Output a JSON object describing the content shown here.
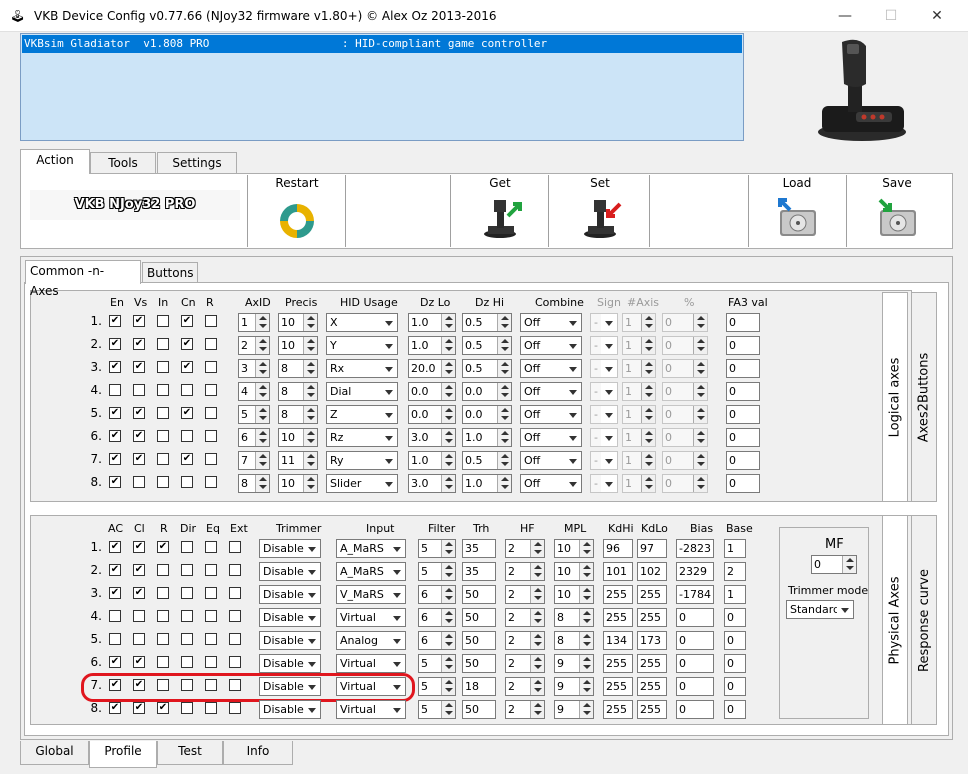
{
  "window": {
    "title": "VKB Device Config v0.77.66 (NJoy32 firmware v1.80+) © Alex Oz 2013-2016"
  },
  "device_list": {
    "selected": "VKBsim Gladiator  v1.808 PRO                    : HID-compliant game controller"
  },
  "top_tabs": [
    {
      "label": "Action"
    },
    {
      "label": "Tools"
    },
    {
      "label": "Settings"
    }
  ],
  "device_name": "VKB NJoy32 PRO",
  "toolbar": {
    "restart": "Restart",
    "get": "Get",
    "set": "Set",
    "load": "Load",
    "save": "Save"
  },
  "inner_tabs": [
    {
      "label": "Common -n- Axes"
    },
    {
      "label": "Buttons"
    }
  ],
  "logical": {
    "headers": {
      "en": "En",
      "vs": "Vs",
      "in": "In",
      "cn": "Cn",
      "r": "R",
      "axid": "AxID",
      "precis": "Precis",
      "hid": "HID Usage",
      "dzlo": "Dz Lo",
      "dzhi": "Dz Hi",
      "combine": "Combine",
      "sign": "Sign",
      "naxis": "#Axis",
      "pct": "%",
      "fa3": "FA3 val"
    },
    "rows": [
      {
        "n": "1.",
        "en": true,
        "vs": true,
        "in": false,
        "cn": true,
        "r": false,
        "axid": "1",
        "precis": "10",
        "hid": "X",
        "dzlo": "1.0",
        "dzhi": "0.5",
        "combine": "Off",
        "sign": "-",
        "naxis": "1",
        "pct": "0",
        "fa3": "0"
      },
      {
        "n": "2.",
        "en": true,
        "vs": true,
        "in": false,
        "cn": true,
        "r": false,
        "axid": "2",
        "precis": "10",
        "hid": "Y",
        "dzlo": "1.0",
        "dzhi": "0.5",
        "combine": "Off",
        "sign": "-",
        "naxis": "1",
        "pct": "0",
        "fa3": "0"
      },
      {
        "n": "3.",
        "en": true,
        "vs": true,
        "in": false,
        "cn": true,
        "r": false,
        "axid": "3",
        "precis": "8",
        "hid": "Rx",
        "dzlo": "20.0",
        "dzhi": "0.5",
        "combine": "Off",
        "sign": "-",
        "naxis": "1",
        "pct": "0",
        "fa3": "0"
      },
      {
        "n": "4.",
        "en": false,
        "vs": false,
        "in": false,
        "cn": false,
        "r": false,
        "axid": "4",
        "precis": "8",
        "hid": "Dial",
        "dzlo": "0.0",
        "dzhi": "0.0",
        "combine": "Off",
        "sign": "-",
        "naxis": "1",
        "pct": "0",
        "fa3": "0"
      },
      {
        "n": "5.",
        "en": true,
        "vs": true,
        "in": false,
        "cn": true,
        "r": false,
        "axid": "5",
        "precis": "8",
        "hid": "Z",
        "dzlo": "0.0",
        "dzhi": "0.0",
        "combine": "Off",
        "sign": "-",
        "naxis": "1",
        "pct": "0",
        "fa3": "0"
      },
      {
        "n": "6.",
        "en": true,
        "vs": true,
        "in": false,
        "cn": false,
        "r": false,
        "axid": "6",
        "precis": "10",
        "hid": "Rz",
        "dzlo": "3.0",
        "dzhi": "1.0",
        "combine": "Off",
        "sign": "-",
        "naxis": "1",
        "pct": "0",
        "fa3": "0"
      },
      {
        "n": "7.",
        "en": true,
        "vs": true,
        "in": false,
        "cn": true,
        "r": false,
        "axid": "7",
        "precis": "11",
        "hid": "Ry",
        "dzlo": "1.0",
        "dzhi": "0.5",
        "combine": "Off",
        "sign": "-",
        "naxis": "1",
        "pct": "0",
        "fa3": "0"
      },
      {
        "n": "8.",
        "en": true,
        "vs": false,
        "in": false,
        "cn": false,
        "r": false,
        "axid": "8",
        "precis": "10",
        "hid": "Slider",
        "dzlo": "3.0",
        "dzhi": "1.0",
        "combine": "Off",
        "sign": "-",
        "naxis": "1",
        "pct": "0",
        "fa3": "0"
      }
    ]
  },
  "physical": {
    "headers": {
      "ac": "AC",
      "cl": "Cl",
      "r": "R",
      "dir": "Dir",
      "eq": "Eq",
      "ext": "Ext",
      "trimmer": "Trimmer",
      "input": "Input",
      "filter": "Filter",
      "trh": "Trh",
      "hf": "HF",
      "mpl": "MPL",
      "kdhi": "KdHi",
      "kdlo": "KdLo",
      "bias": "Bias",
      "base": "Base"
    },
    "rows": [
      {
        "n": "1.",
        "ac": true,
        "cl": true,
        "r": true,
        "dir": false,
        "eq": false,
        "ext": false,
        "trimmer": "Disable",
        "input": "A_MaRS",
        "filter": "5",
        "trh": "35",
        "hf": "2",
        "mpl": "10",
        "kdhi": "96",
        "kdlo": "97",
        "bias": "-2823",
        "base": "1"
      },
      {
        "n": "2.",
        "ac": true,
        "cl": true,
        "r": false,
        "dir": false,
        "eq": false,
        "ext": false,
        "trimmer": "Disable",
        "input": "A_MaRS",
        "filter": "5",
        "trh": "35",
        "hf": "2",
        "mpl": "10",
        "kdhi": "101",
        "kdlo": "102",
        "bias": "2329",
        "base": "2"
      },
      {
        "n": "3.",
        "ac": true,
        "cl": true,
        "r": false,
        "dir": false,
        "eq": false,
        "ext": false,
        "trimmer": "Disable",
        "input": "V_MaRS",
        "filter": "6",
        "trh": "50",
        "hf": "2",
        "mpl": "10",
        "kdhi": "255",
        "kdlo": "255",
        "bias": "-1784",
        "base": "1"
      },
      {
        "n": "4.",
        "ac": false,
        "cl": false,
        "r": false,
        "dir": false,
        "eq": false,
        "ext": false,
        "trimmer": "Disable",
        "input": "Virtual",
        "filter": "6",
        "trh": "50",
        "hf": "2",
        "mpl": "8",
        "kdhi": "255",
        "kdlo": "255",
        "bias": "0",
        "base": "0"
      },
      {
        "n": "5.",
        "ac": false,
        "cl": false,
        "r": false,
        "dir": false,
        "eq": false,
        "ext": false,
        "trimmer": "Disable",
        "input": "Analog",
        "filter": "6",
        "trh": "50",
        "hf": "2",
        "mpl": "8",
        "kdhi": "134",
        "kdlo": "173",
        "bias": "0",
        "base": "0"
      },
      {
        "n": "6.",
        "ac": true,
        "cl": true,
        "r": false,
        "dir": false,
        "eq": false,
        "ext": false,
        "trimmer": "Disable",
        "input": "Virtual",
        "filter": "5",
        "trh": "50",
        "hf": "2",
        "mpl": "9",
        "kdhi": "255",
        "kdlo": "255",
        "bias": "0",
        "base": "0"
      },
      {
        "n": "7.",
        "ac": true,
        "cl": true,
        "r": false,
        "dir": false,
        "eq": false,
        "ext": false,
        "trimmer": "Disable",
        "input": "Virtual",
        "filter": "5",
        "trh": "18",
        "hf": "2",
        "mpl": "9",
        "kdhi": "255",
        "kdlo": "255",
        "bias": "0",
        "base": "0"
      },
      {
        "n": "8.",
        "ac": true,
        "cl": true,
        "r": true,
        "dir": false,
        "eq": false,
        "ext": false,
        "trimmer": "Disable",
        "input": "Virtual",
        "filter": "5",
        "trh": "50",
        "hf": "2",
        "mpl": "9",
        "kdhi": "255",
        "kdlo": "255",
        "bias": "0",
        "base": "0"
      }
    ]
  },
  "mf": {
    "label": "MF",
    "value": "0",
    "trimmer_mode_label": "Trimmer mode",
    "trimmer_mode": "Standard"
  },
  "side_tabs": {
    "logical": "Logical axes",
    "axes2buttons": "Axes2Buttons",
    "physical": "Physical Axes",
    "response": "Response curve"
  },
  "bottom_tabs": [
    {
      "label": "Global"
    },
    {
      "label": "Profile"
    },
    {
      "label": "Test"
    },
    {
      "label": "Info"
    }
  ],
  "colors": {
    "selection": "#0078d7",
    "list_bg": "#cce4f7",
    "highlight": "#e0161e"
  }
}
